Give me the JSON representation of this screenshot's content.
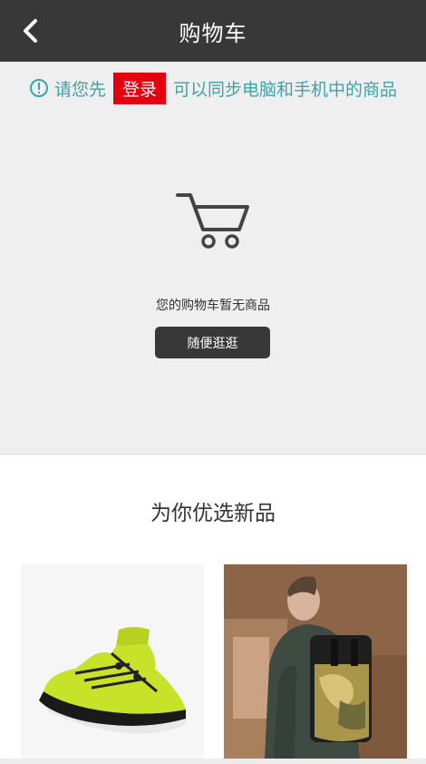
{
  "header": {
    "title": "购物车",
    "back_icon": "chevron-left-icon"
  },
  "notice": {
    "before": "请您先",
    "login_label": "登录",
    "after": "可以同步电脑和手机中的商品",
    "icon": "info-circle-icon",
    "color": "#3ea3a8",
    "login_bg": "#e4000f"
  },
  "empty_cart": {
    "icon": "shopping-cart-icon",
    "message": "您的购物车暂无商品",
    "browse_label": "随便逛逛"
  },
  "recommend": {
    "title": "为你优选新品",
    "products": [
      {
        "image": "neon-yellow-sneaker"
      },
      {
        "image": "man-with-camo-backpack"
      }
    ]
  },
  "colors": {
    "header_bg": "#383838",
    "panel_bg": "#efefef"
  }
}
